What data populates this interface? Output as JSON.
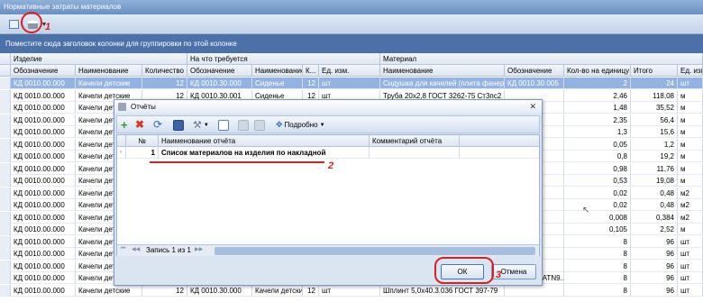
{
  "window": {
    "title": "Нормативные затраты материалов"
  },
  "groupbar": {
    "text": "Поместите сюда заголовок колонки для группировки по этой колонке"
  },
  "grid": {
    "bands": [
      "Изделие",
      "На что требуется",
      "Материал"
    ],
    "columns": [
      "Обозначение",
      "Наименование",
      "Количество",
      "Обозначение",
      "Наименование",
      "К...",
      "Ед. изм.",
      "Наименование",
      "Обозначение",
      "Кол-во на единицу",
      "Итого",
      "Ед. изм."
    ],
    "rows": [
      [
        "КД 0010.00.000",
        "Качели детские",
        "12",
        "КД 0010.30.000",
        "Сиденье",
        "12",
        "шт",
        "Сидушка для качелей (плита фанерн...",
        "КД 0010.30.005",
        "2",
        "24",
        "шт"
      ],
      [
        "КД 0010.00.000",
        "Качели детские",
        "12",
        "КД 0010.30.001",
        "Сиденье",
        "12",
        "шт",
        "Труба 20х2,8 ГОСТ 3262-75 Ст3пс2",
        "",
        "2,46",
        "118,08",
        "м"
      ],
      [
        "КД 0010.00.000",
        "Качели детские",
        "",
        "",
        "",
        "",
        "",
        "",
        "",
        "1,48",
        "35,52",
        "м"
      ],
      [
        "КД 0010.00.000",
        "Качели детские",
        "",
        "",
        "",
        "",
        "",
        "",
        "",
        "2,35",
        "56,4",
        "м"
      ],
      [
        "КД 0010.00.000",
        "Качели детские",
        "",
        "",
        "",
        "",
        "",
        "",
        "",
        "1,3",
        "15,6",
        "м"
      ],
      [
        "КД 0010.00.000",
        "Качели детские",
        "",
        "",
        "",
        "",
        "",
        "",
        "",
        "0,05",
        "1,2",
        "м"
      ],
      [
        "КД 0010.00.000",
        "Качели детские",
        "",
        "",
        "",
        "",
        "",
        "",
        "",
        "0,8",
        "19,2",
        "м"
      ],
      [
        "КД 0010.00.000",
        "Качели детские",
        "",
        "",
        "",
        "",
        "",
        "",
        "",
        "0,98",
        "11,76",
        "м"
      ],
      [
        "КД 0010.00.000",
        "Качели детские",
        "",
        "",
        "",
        "",
        "",
        "",
        "",
        "0,53",
        "19,08",
        "м"
      ],
      [
        "КД 0010.00.000",
        "Качели детские",
        "",
        "",
        "",
        "",
        "",
        "",
        "",
        "0,02",
        "0,48",
        "м2"
      ],
      [
        "КД 0010.00.000",
        "Качели детские",
        "",
        "",
        "",
        "",
        "",
        "",
        "",
        "0,02",
        "0,48",
        "м2"
      ],
      [
        "КД 0010.00.000",
        "Качели детские",
        "",
        "",
        "",
        "",
        "",
        "",
        "",
        "0,008",
        "0,384",
        "м2"
      ],
      [
        "КД 0010.00.000",
        "Качели детские",
        "",
        "",
        "",
        "",
        "",
        "",
        "",
        "0,105",
        "2,52",
        "м"
      ],
      [
        "КД 0010.00.000",
        "Качели детские",
        "",
        "",
        "",
        "",
        "",
        "",
        "",
        "8",
        "96",
        "шт"
      ],
      [
        "КД 0010.00.000",
        "Качели детские",
        "",
        "",
        "",
        "",
        "",
        "",
        "",
        "8",
        "96",
        "шт"
      ],
      [
        "КД 0010.00.000",
        "Качели детские",
        "",
        "",
        "",
        "",
        "",
        "",
        "",
        "8",
        "96",
        "шт"
      ],
      [
        "КД 0010.00.000",
        "Качели детские",
        "12",
        "КД 0010.30.000",
        "Сиденье",
        "12",
        "шт",
        "Подшипник",
        "3206-2RS-ATN9...",
        "8",
        "96",
        "шт"
      ],
      [
        "КД 0010.00.000",
        "Качели детские",
        "12",
        "КД 0010.30.000",
        "Качели детские",
        "12",
        "шт",
        "Шплинт 5,0х40.3.036 ГОСТ 397-79",
        "",
        "8",
        "96",
        "шт"
      ]
    ]
  },
  "dialog": {
    "title": "Отчёты",
    "close_glyph": "✕",
    "detail_label": "Подробно",
    "columns": [
      "№",
      "Наименование отчёта",
      "Комментарий отчёта"
    ],
    "rows": [
      {
        "num": "1",
        "name": "Список материалов на изделия по накладной",
        "comment": ""
      }
    ],
    "footer": "Запись 1 из 1",
    "ok_label": "ОК",
    "cancel_label": "Отмена"
  },
  "markers": [
    "1",
    "2",
    "3"
  ],
  "colors": {
    "annotation": "#d92020",
    "selected_row": "#95b3e2",
    "title_bar": "#6a90c2"
  }
}
